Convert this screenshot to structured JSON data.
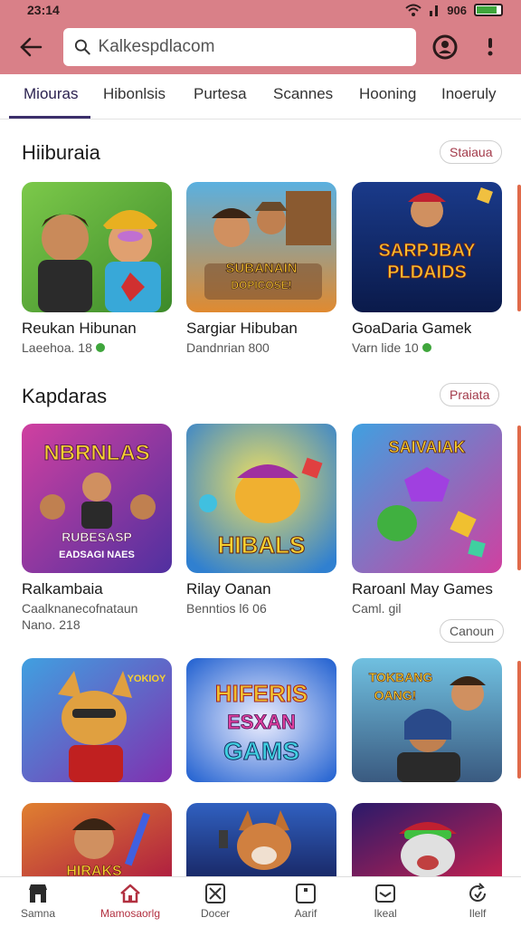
{
  "status": {
    "time": "23:14",
    "battery": "906",
    "battery_level": 0.8
  },
  "search": {
    "placeholder": "Kalkespdlacom"
  },
  "tabs": [
    "Miouras",
    "Hibonlsis",
    "Purtesa",
    "Scannes",
    "Hooning",
    "Inoeruly"
  ],
  "sections": [
    {
      "title": "Hiiburaia",
      "action": "Staiaua",
      "cards": [
        {
          "title": "Reukan Hibunan",
          "sub": "Laeehoa. 18",
          "thumb_text": ""
        },
        {
          "title": "Sargiar Hibuban",
          "sub": "Dandnrian 800",
          "thumb_text": "SUBANAIN DOPICOSE!"
        },
        {
          "title": "GoaDaria Gamek",
          "sub": "Varn lide 10",
          "thumb_text": "SARPJBAY PLDAIDS"
        }
      ]
    },
    {
      "title": "Kapdaras",
      "action": "Praiata",
      "cards": [
        {
          "title": "Ralkambaia",
          "sub": "Caalknanecofnataun",
          "sub2": "Nano. 218",
          "thumb_text": "NBRNLAS",
          "thumb_text2": "RUBESASP EADSAGI NAES"
        },
        {
          "title": "Rilay Oanan",
          "sub": "Benntios l6 06",
          "thumb_text": "HIBALS"
        },
        {
          "title": "Raroanl May Games",
          "sub": "Caml. gil",
          "thumb_text": "SAIVAIAK"
        }
      ]
    }
  ],
  "more_button": "Canoun",
  "row3_cards": [
    {
      "thumb_text": "YOKIOY"
    },
    {
      "thumb_text": "HIFERIS ESXAN GAMS"
    },
    {
      "thumb_text": "TOKBANG OANG!"
    }
  ],
  "row4_cards": [
    {
      "thumb_text": "HIRAKS"
    },
    {
      "thumb_text": ""
    },
    {
      "thumb_text": ""
    }
  ],
  "bottom_nav": [
    {
      "label": "Samna",
      "icon": "store-icon"
    },
    {
      "label": "Mamosaorlg",
      "icon": "home-icon"
    },
    {
      "label": "Docer",
      "icon": "cross-box-icon"
    },
    {
      "label": "Aarif",
      "icon": "square-icon"
    },
    {
      "label": "Ikeal",
      "icon": "mail-icon"
    },
    {
      "label": "Ilelf",
      "icon": "refresh-icon"
    }
  ],
  "colors": {
    "accent": "#d98088",
    "active_tab": "#3b2f6b",
    "active_nav": "#b23040"
  }
}
